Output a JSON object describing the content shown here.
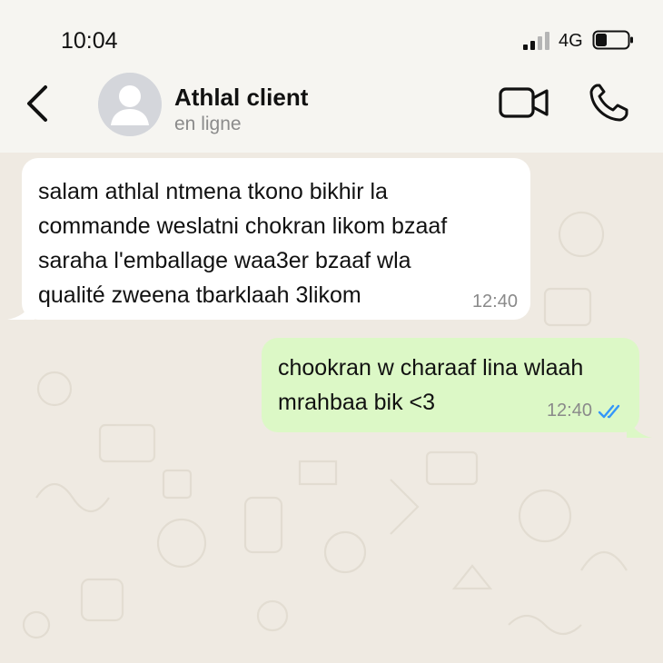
{
  "status_bar": {
    "time": "10:04",
    "network": "4G",
    "signal_icon": "signal-bars-icon",
    "battery_icon": "battery-low-icon"
  },
  "header": {
    "back_icon": "chevron-left-icon",
    "contact_name": "Athlal client",
    "contact_status": "en ligne",
    "video_icon": "video-camera-icon",
    "call_icon": "phone-icon"
  },
  "messages": [
    {
      "direction": "incoming",
      "text": "salam athlal ntmena tkono bikhir la\ncommande weslatni chokran likom bzaaf\nsaraha l'emballage waa3er bzaaf wla\nqualité zweena tbarklaah 3likom",
      "time": "12:40"
    },
    {
      "direction": "outgoing",
      "text": "chookran w charaaf lina wlaah\nmrahbaa bik <3",
      "time": "12:40",
      "read_icon": "double-check-icon"
    }
  ],
  "colors": {
    "background": "#f6f5f1",
    "chat_background": "#efeae2",
    "incoming_bubble": "#ffffff",
    "outgoing_bubble": "#dcf8c6",
    "read_check": "#3497f9"
  }
}
